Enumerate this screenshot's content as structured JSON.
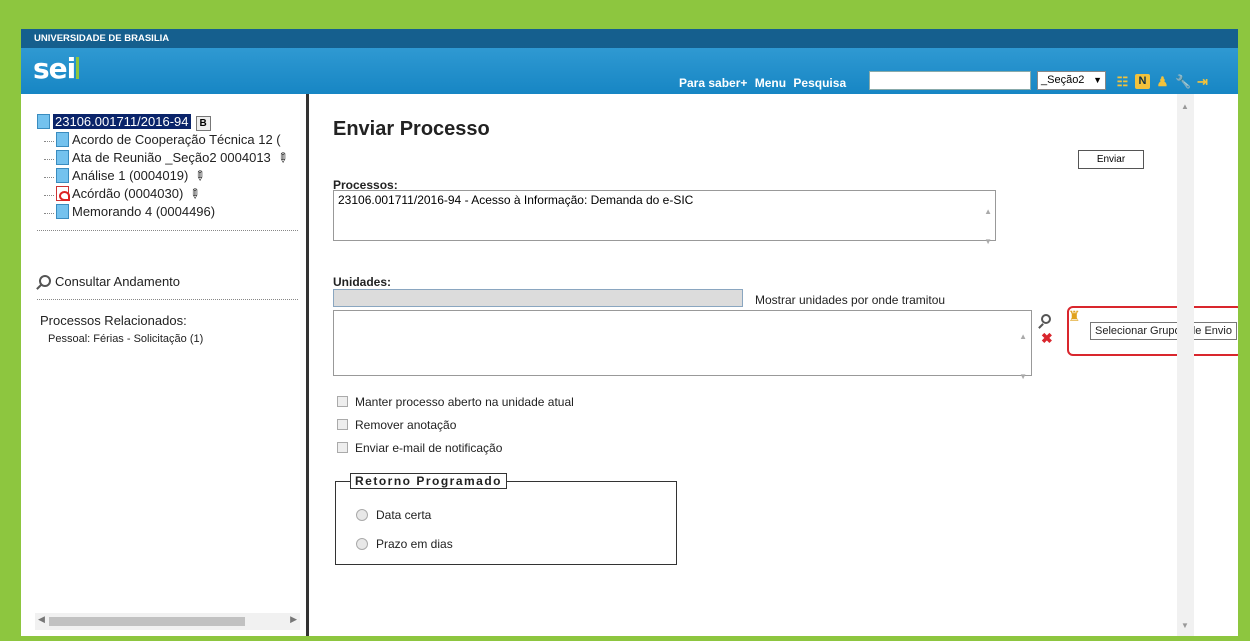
{
  "header": {
    "university": "UNIVERSIDADE DE BRASILIA",
    "logo": "sei",
    "nav": [
      "Para saber+",
      "Menu",
      "Pesquisa"
    ],
    "search_value": "",
    "unit_select": "_Seção2",
    "icons": [
      "list-icon",
      "n-icon",
      "user-icon",
      "wrench-icon",
      "exit-icon"
    ]
  },
  "tree": {
    "root": "23106.001711/2016-94",
    "root_badge": "B",
    "items": [
      {
        "label": "Acordo de Cooperação Técnica 12 (",
        "icon": "document-icon"
      },
      {
        "label": "Ata de Reunião _Seção2 0004013",
        "icon": "document-icon"
      },
      {
        "label": "Análise 1 (0004019)",
        "icon": "document-icon"
      },
      {
        "label": "Acórdão (0004030)",
        "icon": "pdf-icon"
      },
      {
        "label": "Memorando 4 (0004496)",
        "icon": "document-icon"
      }
    ],
    "consult": "Consultar Andamento",
    "related_title": "Processos Relacionados:",
    "related_item": "Pessoal: Férias - Solicitação (1)"
  },
  "main": {
    "title": "Enviar Processo",
    "send_button": "Enviar",
    "processes_label": "Processos:",
    "processes_value": "23106.001711/2016-94 - Acesso à Informação: Demanda do e-SIC",
    "units_label": "Unidades:",
    "units_input_value": "",
    "units_hint": "Mostrar unidades por onde tramitou",
    "tooltip": "Selecionar Grupos de Envio",
    "checkboxes": [
      "Manter processo aberto na unidade atual",
      "Remover anotação",
      "Enviar e-mail de notificação"
    ],
    "return_legend": "Retorno Programado",
    "radios": [
      "Data certa",
      "Prazo em dias"
    ]
  }
}
